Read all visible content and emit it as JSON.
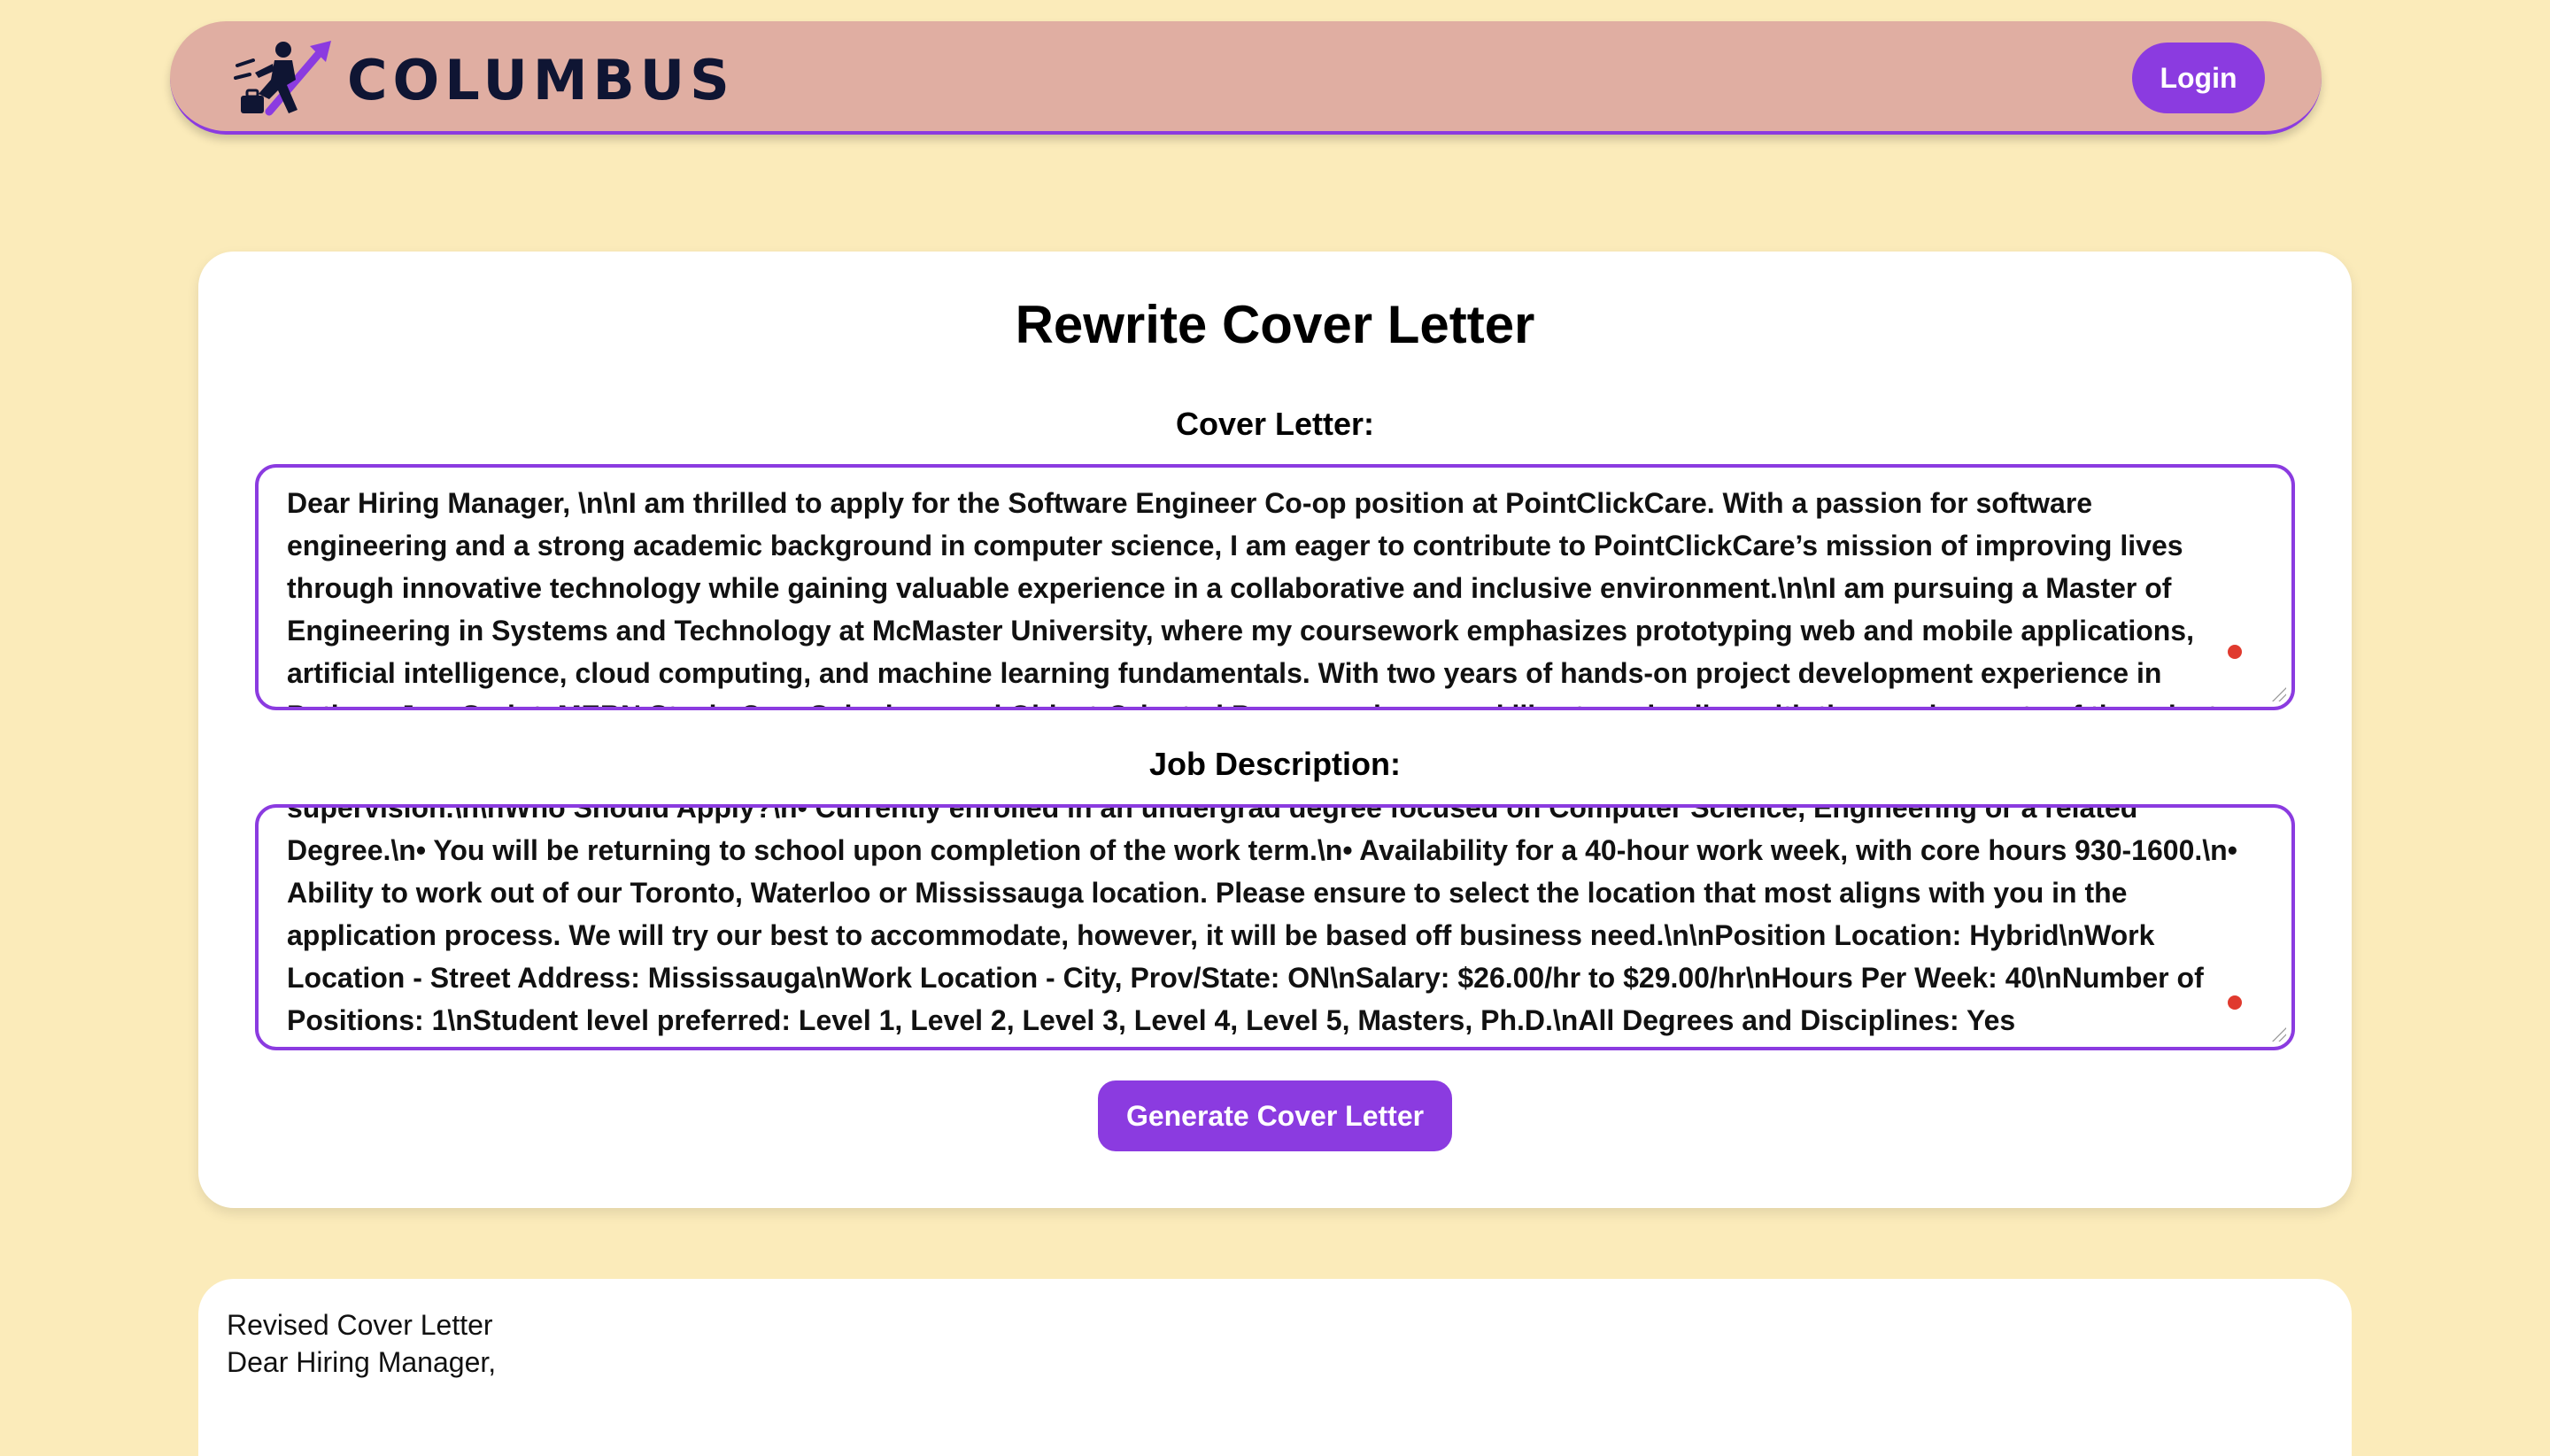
{
  "header": {
    "brand": "COLUMBUS",
    "login_label": "Login",
    "logo_icon": "rocket-runner-logo-icon",
    "accent_color": "#8B3BE0"
  },
  "main": {
    "title": "Rewrite Cover Letter",
    "cover_letter_label": "Cover Letter:",
    "cover_letter_value": "Dear Hiring Manager, \\n\\nI am thrilled to apply for the Software Engineer Co-op position at PointClickCare. With a passion for software engineering and a strong academic background in computer science, I am eager to contribute to PointClickCare’s mission of improving lives through innovative technology while gaining valuable experience in a collaborative and inclusive environment.\\n\\nI am pursuing a Master of Engineering in Systems and Technology at McMaster University, where my coursework emphasizes prototyping web and mobile applications, artificial intelligence, cloud computing, and machine learning fundamentals. With two years of hands-on project development experience in Python, JavaScript, MERN Stack, C++, Selenium, and Object-Oriented Programming, my skills strongly align with the requirements of the role, t",
    "job_description_label": "Job Description:",
    "job_description_value": "supervision.\\n\\nWho Should Apply?\\n• Currently enrolled in an undergrad degree focused on Computer Science, Engineering or a related Degree.\\n• You will be returning to school upon completion of the work term.\\n• Availability for a 40-hour work week, with core hours 930-1600.\\n• Ability to work out of our Toronto, Waterloo or Mississauga location. Please ensure to select the location that most aligns with you in the application process. We will try our best to accommodate, however, it will be based off business need.\\n\\nPosition Location: Hybrid\\nWork Location - Street Address: Mississauga\\nWork Location - City, Prov/State: ON\\nSalary: $26.00/hr to $29.00/hr\\nHours Per Week: 40\\nNumber of Positions: 1\\nStudent level preferred: Level 1, Level 2, Level 3, Level 4, Level 5, Masters, Ph.D.\\nAll Degrees and Disciplines: Yes",
    "generate_label": "Generate Cover Letter"
  },
  "result": {
    "heading": "Revised Cover Letter",
    "first_line": "Dear Hiring Manager,"
  }
}
